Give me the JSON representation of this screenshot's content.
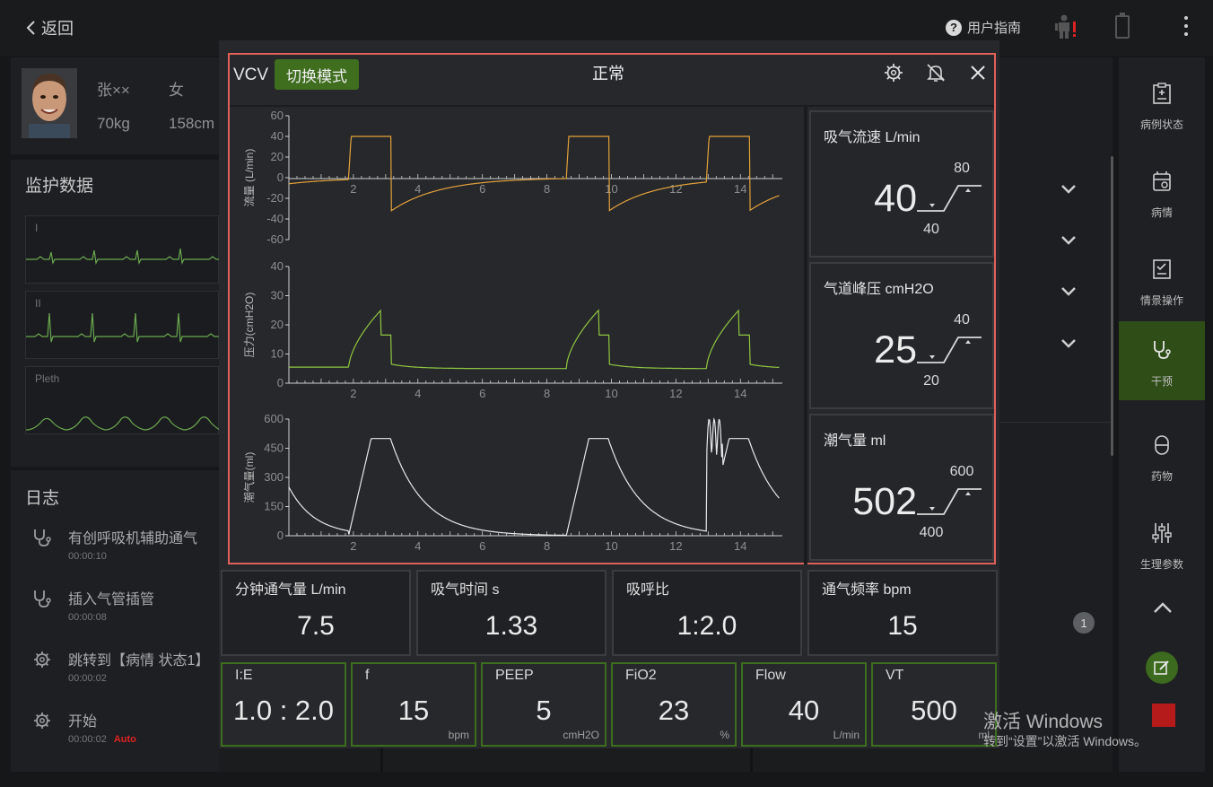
{
  "topbar": {
    "back_label": "返回",
    "guide_label": "用户指南"
  },
  "patient": {
    "name": "张××",
    "gender": "女",
    "weight": "70kg",
    "height": "158cm"
  },
  "monitor": {
    "title": "监护数据",
    "leads": [
      "I",
      "II",
      "Pleth"
    ]
  },
  "log": {
    "title": "日志",
    "items": [
      {
        "icon": "stethoscope-icon",
        "text": "有创呼吸机辅助通气",
        "time": "00:00:10"
      },
      {
        "icon": "stethoscope-icon",
        "text": "插入气管插管",
        "time": "00:00:08"
      },
      {
        "icon": "gear-icon",
        "text": "跳转到【病情 状态1】",
        "time": "00:00:02"
      },
      {
        "icon": "gear-icon",
        "text": "开始",
        "time": "00:00:02",
        "badge": "Auto"
      }
    ]
  },
  "sidebar": {
    "items": [
      {
        "label": "病例状态",
        "icon": "clipboard-plus-icon"
      },
      {
        "label": "病情",
        "icon": "monitor-case-icon"
      },
      {
        "label": "情景操作",
        "icon": "checklist-icon"
      },
      {
        "label": "干预",
        "icon": "stethoscope-icon",
        "active": true
      },
      {
        "label": "药物",
        "icon": "capsule-icon"
      },
      {
        "label": "生理参数",
        "icon": "sliders-icon"
      }
    ]
  },
  "background": {
    "badge_count": "1"
  },
  "ventilator": {
    "mode": "VCV",
    "switch_label": "切换模式",
    "status": "正常",
    "measurements": [
      {
        "label": "吸气流速  L/min",
        "value": "40",
        "high": "80",
        "low": "40"
      },
      {
        "label": "气道峰压  cmH2O",
        "value": "25",
        "high": "40",
        "low": "20"
      },
      {
        "label": "潮气量  ml",
        "value": "502",
        "high": "600",
        "low": "400"
      }
    ],
    "stats": [
      {
        "label": "分钟通气量  L/min",
        "value": "7.5"
      },
      {
        "label": "吸气时间  s",
        "value": "1.33"
      },
      {
        "label": "吸呼比",
        "value": "1:2.0"
      },
      {
        "label": "通气频率  bpm",
        "value": "15"
      }
    ],
    "settings": [
      {
        "name": "I:E",
        "value": "1.0 : 2.0",
        "unit": ""
      },
      {
        "name": "f",
        "value": "15",
        "unit": "bpm"
      },
      {
        "name": "PEEP",
        "value": "5",
        "unit": "cmH2O"
      },
      {
        "name": "FiO2",
        "value": "23",
        "unit": "%"
      },
      {
        "name": "Flow",
        "value": "40",
        "unit": "L/min"
      },
      {
        "name": "VT",
        "value": "500",
        "unit": "ml"
      }
    ],
    "waveforms": [
      {
        "ylabel": "流量 (L/min)",
        "yticks": [
          "60",
          "40",
          "20",
          "0",
          "-20",
          "-40",
          "-60"
        ],
        "xticks": [
          "2",
          "4",
          "6",
          "8",
          "10",
          "12",
          "14"
        ]
      },
      {
        "ylabel": "压力(cmH2O)",
        "yticks": [
          "40",
          "30",
          "20",
          "10",
          "0"
        ],
        "xticks": [
          "2",
          "4",
          "6",
          "8",
          "10",
          "12",
          "14"
        ]
      },
      {
        "ylabel": "潮气量(ml)",
        "yticks": [
          "600",
          "450",
          "300",
          "150",
          "0"
        ],
        "xticks": [
          "2",
          "4",
          "6",
          "8",
          "10",
          "12",
          "14"
        ]
      }
    ]
  },
  "watermark": {
    "line1": "激活 Windows",
    "line2": "转到“设置”以激活 Windows。"
  },
  "colors": {
    "flow_wave": "#e3a13a",
    "pressure_wave": "#8ec63f",
    "volume_wave": "#e8e8e8",
    "accent_green": "#3f6e1f",
    "alert_red": "#e0605a"
  }
}
